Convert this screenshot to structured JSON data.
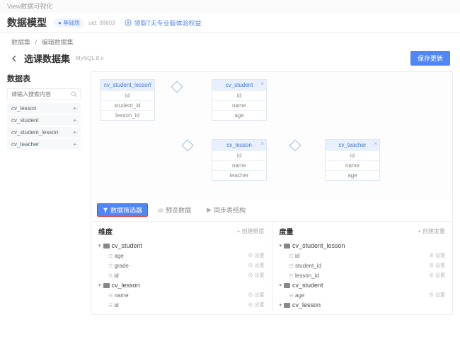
{
  "topbar": {
    "brand": "View数据可视化"
  },
  "header": {
    "title": "数据模型",
    "badge": "基础版",
    "uid": "uid: 38803",
    "promo": "领取7天专业版体验权益"
  },
  "crumbs": {
    "a": "数据集",
    "sep": "/",
    "b": "编辑数据集"
  },
  "titlebar": {
    "title": "选课数据集",
    "db": "MySQL 8.x",
    "save": "保存更新"
  },
  "side": {
    "title": "数据表",
    "search_ph": "请输入搜索内容",
    "items": [
      "cv_lesson",
      "cv_student",
      "cv_student_lesson",
      "cv_teacher"
    ]
  },
  "entities": {
    "e1": {
      "name": "cv_student_lesson",
      "fields": [
        "id",
        "student_id",
        "lesson_id"
      ]
    },
    "e2": {
      "name": "cv_student",
      "fields": [
        "id",
        "name",
        "age"
      ]
    },
    "e3": {
      "name": "cv_lesson",
      "fields": [
        "id",
        "name",
        "teacher"
      ]
    },
    "e4": {
      "name": "cv_teacher",
      "fields": [
        "id",
        "name",
        "age"
      ]
    }
  },
  "tabs": {
    "t1": "数据筛选器",
    "t2": "预览数据",
    "t3": "同步表结构"
  },
  "dims": {
    "title": "维度",
    "add": "+ 创建维度",
    "g1": {
      "name": "cv_student",
      "rows": [
        [
          "age",
          "设置"
        ],
        [
          "grade",
          "设置"
        ],
        [
          "id",
          "设置"
        ]
      ]
    },
    "g2": {
      "name": "cv_lesson",
      "rows": [
        [
          "name",
          "设置"
        ],
        [
          "id",
          "设置"
        ]
      ]
    }
  },
  "meas": {
    "title": "度量",
    "add": "+ 创建度量",
    "g1": {
      "name": "cv_student_lesson",
      "rows": [
        [
          "id",
          "设置"
        ],
        [
          "student_id",
          "设置"
        ],
        [
          "lesson_id",
          "设置"
        ]
      ]
    },
    "g2": {
      "name": "cv_student",
      "rows": [
        [
          "age",
          "设置"
        ]
      ]
    },
    "g3": {
      "name": "cv_lesson"
    }
  }
}
